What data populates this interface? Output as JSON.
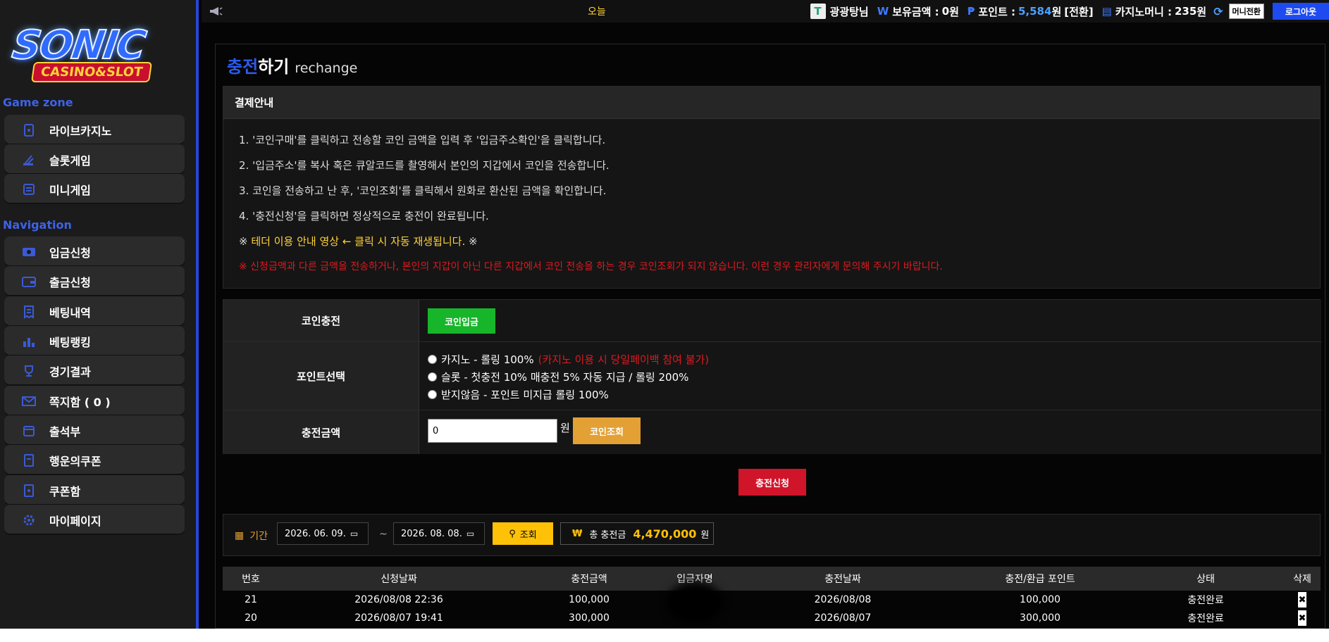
{
  "logo": {
    "word": "SONIC",
    "sub": "CASINO&SLOT"
  },
  "sidebar": {
    "game_title": "Game zone",
    "game_items": [
      {
        "label": "라이브카지노",
        "icon": "card-icon"
      },
      {
        "label": "슬롯게임",
        "icon": "slot-icon"
      },
      {
        "label": "미니게임",
        "icon": "mini-game-icon"
      }
    ],
    "nav_title": "Navigation",
    "nav_items": [
      {
        "label": "입금신청",
        "icon": "deposit-icon"
      },
      {
        "label": "출금신청",
        "icon": "wallet-icon"
      },
      {
        "label": "베팅내역",
        "icon": "receipt-icon"
      },
      {
        "label": "베팅랭킹",
        "icon": "ranking-icon"
      },
      {
        "label": "경기결과",
        "icon": "trophy-icon"
      },
      {
        "label": "쪽지함 ( 0 )",
        "icon": "message-icon"
      },
      {
        "label": "출석부",
        "icon": "calendar-icon"
      },
      {
        "label": "행운의쿠폰",
        "icon": "coupon-icon"
      },
      {
        "label": "쿠폰함",
        "icon": "coupon-box-icon"
      },
      {
        "label": "마이페이지",
        "icon": "gear-icon"
      }
    ]
  },
  "topbar": {
    "today": "오늘",
    "username": "광광탕님",
    "balance_label": "보유금액 :",
    "balance_value": "0",
    "balance_unit": "원",
    "point_label": "포인트 :",
    "point_value": "5,584",
    "point_unit": "원",
    "convert_label": "[전환]",
    "casino_label": "카지노머니 :",
    "casino_value": "235",
    "casino_unit": "원",
    "money_convert_btn": "머니전환",
    "logout_btn": "로그아웃"
  },
  "page": {
    "title_part1": "충전",
    "title_part2": "하기",
    "title_en": "rechange"
  },
  "notice": {
    "header": "결제안내",
    "lines": [
      "1. '코인구매'를 클릭하고 전송할 코인 금액을 입력 후 '입금주소확인'을 클릭합니다.",
      "2. '입금주소'를 복사 혹은 큐알코드를 촬영해서 본인의 지갑에서 코인을 전송합니다.",
      "3. 코인을 전송하고 난 후, '코인조회'를 클릭해서 원화로 환산된 금액을 확인합니다.",
      "4. '충전신청'을 클릭하면 정상적으로 충전이 완료됩니다."
    ],
    "video_prefix": "※",
    "video_text": "테더 이용 안내 영상 ← 클릭 시 자동 재생됩니다.",
    "video_suffix": "※",
    "warning": "※ 신청금액과 다른 금액을 전송하거나, 본인의 지갑이 아닌 다른 지갑에서 코인 전송을 하는 경우 코인조회가 되지 않습니다. 이런 경우 관리자에게 문의해 주시기 바랍니다."
  },
  "form": {
    "coin_label": "코인충전",
    "coin_btn": "코인입금",
    "point_label": "포인트선택",
    "options": [
      {
        "text": "카지노 - 롤링 100%",
        "note": "(카지노 이용 시 당일페이백 참여 불가)"
      },
      {
        "text": "슬롯 - 첫충전 10% 매충전 5% 자동 지급 / 롤링 200%",
        "note": ""
      },
      {
        "text": "받지않음 - 포인트 미지급 롤링 100%",
        "note": ""
      }
    ],
    "amount_label": "충전금액",
    "amount_value": "0",
    "amount_unit": "원",
    "lookup_btn": "코인조회",
    "submit_btn": "충전신청"
  },
  "filter": {
    "period_label": "기간",
    "date_from": "2026. 06. 09.",
    "date_to": "2026. 08. 08.",
    "tilde": "~",
    "search_btn": "조회",
    "total_symbol": "₩",
    "total_label": "총 충전금",
    "total_value": "4,470,000",
    "total_unit": "원"
  },
  "table": {
    "headers": [
      "번호",
      "신청날짜",
      "충전금액",
      "입금자명",
      "충전날짜",
      "충전/환급 포인트",
      "상태",
      "삭제"
    ],
    "rows": [
      {
        "no": "21",
        "req_date": "2026/08/08 22:36",
        "amount": "100,000",
        "depositor": "",
        "charge_date": "2026/08/08",
        "points": "100,000",
        "status": "충전완료",
        "del": "✖"
      },
      {
        "no": "20",
        "req_date": "2026/08/07 19:41",
        "amount": "300,000",
        "depositor": "",
        "charge_date": "2026/08/07",
        "points": "300,000",
        "status": "충전완료",
        "del": "✖"
      }
    ]
  },
  "colors": {
    "accent": "#2b5bf0",
    "green": "#17b52a",
    "orange": "#e3a034",
    "red": "#d0142a",
    "yellow": "#ffd23a"
  }
}
